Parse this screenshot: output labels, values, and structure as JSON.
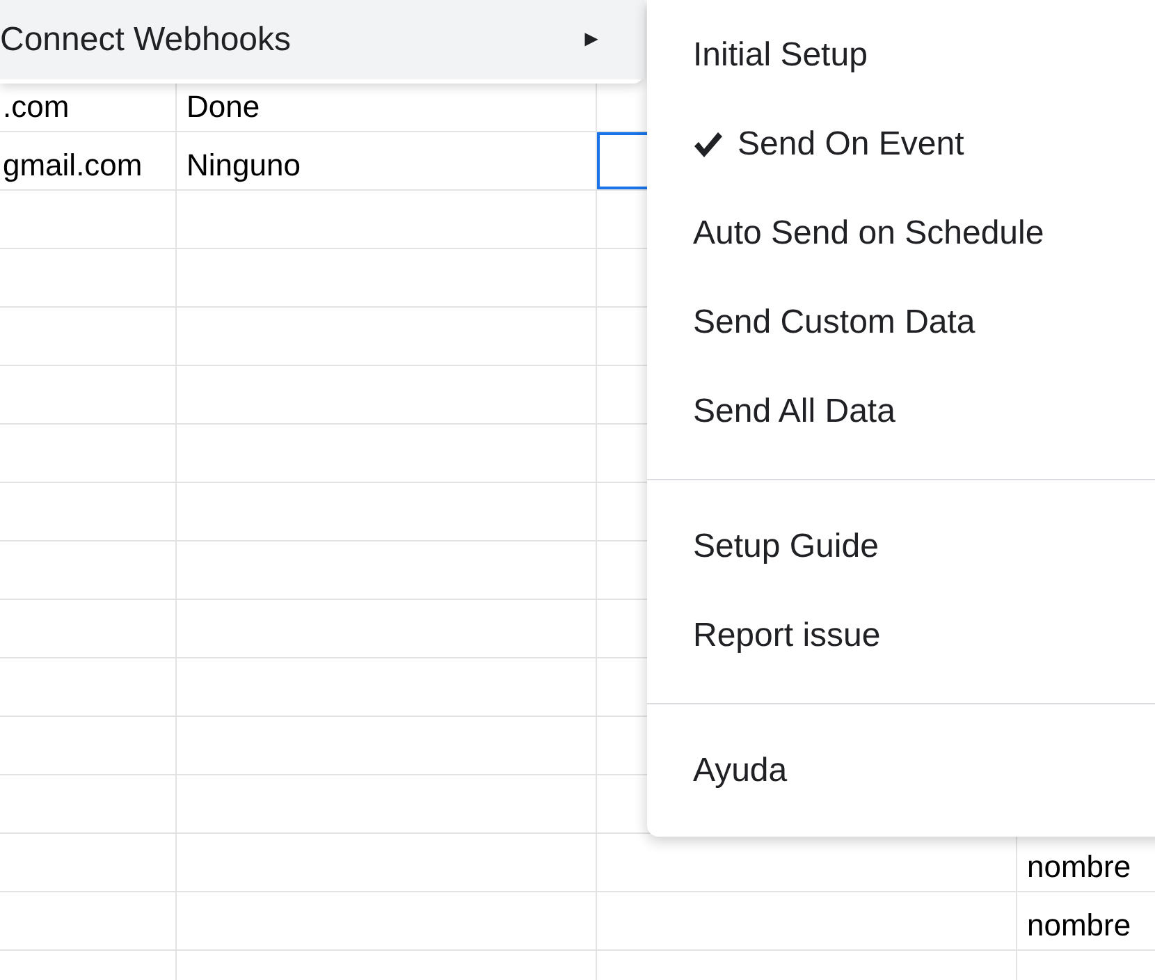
{
  "sheet": {
    "rows": [
      {
        "cells": [
          {
            "text": ".com",
            "selected": false
          },
          {
            "text": "Done",
            "selected": false
          },
          {
            "selected": false
          }
        ]
      },
      {
        "cells": [
          {
            "text": "gmail.com",
            "selected": false
          },
          {
            "text": "Ninguno",
            "selected": false
          },
          {
            "selected": true
          }
        ]
      },
      {
        "cells": [
          {
            "selected": false
          },
          {
            "selected": false
          },
          {
            "selected": false
          }
        ]
      },
      {
        "cells": [
          {
            "selected": false
          },
          {
            "selected": false
          },
          {
            "selected": false
          }
        ]
      },
      {
        "cells": [
          {
            "selected": false
          },
          {
            "selected": false
          },
          {
            "selected": false
          }
        ]
      },
      {
        "cells": [
          {
            "selected": false
          },
          {
            "selected": false
          },
          {
            "selected": false
          }
        ]
      },
      {
        "cells": [
          {
            "selected": false
          },
          {
            "selected": false
          },
          {
            "selected": false
          }
        ]
      },
      {
        "cells": [
          {
            "selected": false
          },
          {
            "selected": false
          },
          {
            "selected": false
          }
        ]
      },
      {
        "cells": [
          {
            "selected": false
          },
          {
            "selected": false
          },
          {
            "selected": false
          }
        ]
      },
      {
        "cells": [
          {
            "selected": false
          },
          {
            "selected": false
          },
          {
            "selected": false
          }
        ]
      },
      {
        "cells": [
          {
            "selected": false
          },
          {
            "selected": false
          },
          {
            "selected": false
          }
        ]
      },
      {
        "cells": [
          {
            "selected": false
          },
          {
            "selected": false
          },
          {
            "selected": false
          }
        ]
      },
      {
        "cells": [
          {
            "selected": false
          },
          {
            "selected": false
          },
          {
            "selected": false
          }
        ]
      },
      {
        "cells": [
          {
            "selected": false
          },
          {
            "selected": false
          },
          {
            "selected": false
          },
          {
            "text": "nombre",
            "selected": false
          }
        ]
      },
      {
        "cells": [
          {
            "selected": false
          },
          {
            "selected": false
          },
          {
            "selected": false
          },
          {
            "text": "nombre",
            "selected": false
          }
        ]
      },
      {
        "cells": [
          {
            "selected": false
          },
          {
            "selected": false
          },
          {
            "selected": false
          }
        ]
      }
    ]
  },
  "menu": {
    "items": [
      {
        "label": "Connect Webhooks",
        "arrow": "►",
        "highlighted": true
      }
    ]
  },
  "submenu": {
    "groups": [
      [
        {
          "label": "Initial Setup",
          "checked": false
        },
        {
          "label": "Send On Event",
          "checked": true
        },
        {
          "label": "Auto Send on Schedule",
          "checked": false
        },
        {
          "label": "Send Custom Data",
          "checked": false
        },
        {
          "label": "Send All Data",
          "checked": false
        }
      ],
      [
        {
          "label": "Setup Guide",
          "checked": false
        },
        {
          "label": "Report issue",
          "checked": false
        }
      ],
      [
        {
          "label": "Ayuda",
          "checked": false
        }
      ]
    ]
  }
}
